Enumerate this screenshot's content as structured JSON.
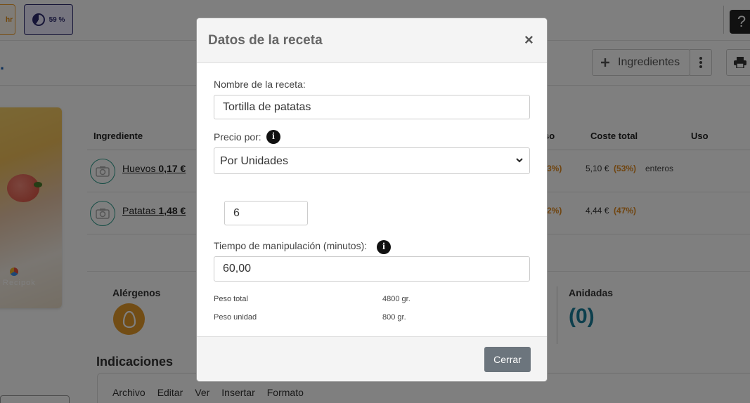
{
  "topbar": {
    "hr_chip": "hr",
    "progress_chip": "59 %",
    "progress_value": 0.59,
    "help": "?"
  },
  "subbar": {
    "title_fragment": ".",
    "ingredients_button": "Ingredientes"
  },
  "table": {
    "headers": {
      "ingredient": "Ingrediente",
      "peso_fragment": "so",
      "total_cost": "Coste total",
      "use": "Uso"
    },
    "rows": [
      {
        "name": "Huevos",
        "price": "0,17 €",
        "peso_fragment": "3%)",
        "cost": "5,10 €",
        "cost_pct": "(53%)",
        "use": "enteros"
      },
      {
        "name": "Patatas",
        "price": "1,48 €",
        "peso_fragment": "2%)",
        "cost": "4,44 €",
        "cost_pct": "(47%)",
        "use": ""
      }
    ]
  },
  "photo": {
    "brand": "Recipok"
  },
  "sections": {
    "allergens": "Alérgenos",
    "nested": "Anidadas",
    "nested_count": "(0)",
    "instructions": "Indicaciones"
  },
  "editor": {
    "menu": [
      "Archivo",
      "Editar",
      "Ver",
      "Insertar",
      "Formato"
    ]
  },
  "modal": {
    "title": "Datos de la receta",
    "close_symbol": "×",
    "recipe_name_label": "Nombre de la receta:",
    "recipe_name_value": "Tortilla de patatas",
    "price_by_label": "Precio por:",
    "price_by_value": "Por Unidades",
    "units_value": "6",
    "handling_time_label": "Tiempo de manipulación (minutos):",
    "handling_time_value": "60,00",
    "total_weight_label": "Peso total",
    "total_weight_value": "4800 gr.",
    "unit_weight_label": "Peso unidad",
    "unit_weight_value": "800 gr.",
    "close_button": "Cerrar"
  },
  "colors": {
    "accent_teal": "#1a7f9a",
    "orange": "#e08a20",
    "button_gray": "#6c757d"
  }
}
